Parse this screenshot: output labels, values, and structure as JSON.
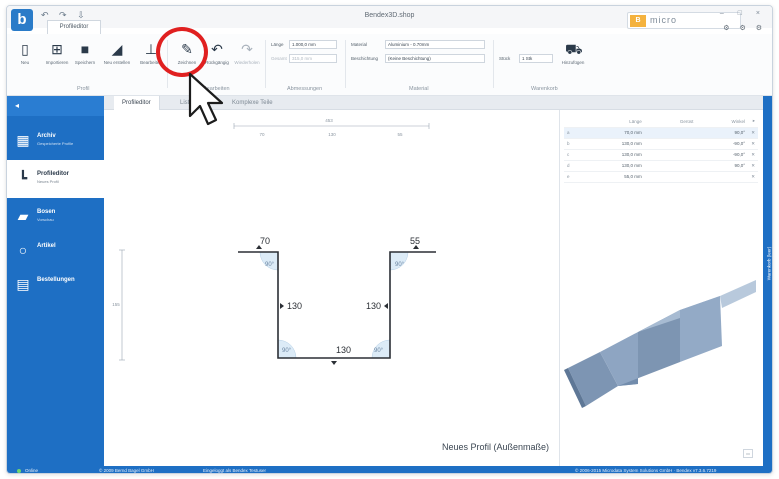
{
  "app": {
    "logo_letter": "b",
    "quick_access": "↶ ↷ ⇩",
    "title": "Bendex3D.shop",
    "tab": "Profileditor",
    "brand_mark": "B",
    "brand_text": "micro",
    "window_controls": "– □ ×",
    "window_controls_2": "⚙ ⚙ ⚙"
  },
  "ribbon": {
    "buttons": [
      {
        "label": "Neu",
        "icon": "new-file-icon"
      },
      {
        "label": "Importieren",
        "icon": "import-icon"
      },
      {
        "label": "Speichern",
        "icon": "save-icon"
      },
      {
        "label": "Neu erstellen",
        "icon": "bend-icon"
      },
      {
        "label": "Bearbeiten",
        "icon": "edit-profile-icon"
      },
      {
        "label": "Zeichnen",
        "icon": "draw-icon"
      },
      {
        "label": "Rückgängig",
        "icon": "undo-icon"
      },
      {
        "label": "Wiederholen",
        "icon": "redo-icon"
      }
    ],
    "groups": {
      "profil": "Profil",
      "bearbeiten": "Bearbeiten",
      "abmessungen": "Abmessungen",
      "material": "Material",
      "warenkorb": "Warenkorb"
    },
    "fields": {
      "laenge_label": "Länge",
      "laenge_value": "1.000,0 mm",
      "gesamt_label": "Gesamt",
      "gesamt_value": "315,0 mm",
      "material_label": "Material",
      "material_value": "Aluminium - 0.70mm",
      "beschichtung_label": "Beschichtung",
      "beschichtung_value": "(Keine Beschichtung)",
      "stueck_label": "Stück",
      "stueck_value": "1 Stk",
      "hinzufuegen_label": "Hinzufügen"
    }
  },
  "sidebar": {
    "collapse": "◂",
    "items": [
      {
        "title": "Archiv",
        "sub": "Gespeicherte Profile",
        "icon": "archive-icon"
      },
      {
        "title": "Profileditor",
        "sub": "Neues Profil",
        "icon": "profile-editor-icon"
      },
      {
        "title": "Bosen",
        "sub": "Vorschau",
        "icon": "sheets-icon"
      },
      {
        "title": "Artikel",
        "sub": "",
        "icon": "article-icon"
      },
      {
        "title": "Bestellungen",
        "sub": "",
        "icon": "orders-icon"
      }
    ]
  },
  "content_tabs": [
    "Profileditor",
    "Liste",
    "Komplexe Teile"
  ],
  "drawing": {
    "dims": {
      "top_left": "70",
      "top_right": "55",
      "left_mid": "130",
      "right_mid": "130",
      "bottom": "130"
    },
    "angles": [
      "90°",
      "90°",
      "90°",
      "90°"
    ],
    "ruler_top": [
      "453",
      "70",
      "130",
      "55"
    ],
    "ruler_left": "155",
    "profile_name": "Neues Profil (Außenmaße)"
  },
  "segments": {
    "headers": [
      "",
      "Länge",
      "Gerüst",
      "Winkel"
    ],
    "rows": [
      {
        "idx": "a",
        "length": "70,0 mm",
        "angle": "90,0°"
      },
      {
        "idx": "b",
        "length": "130,0 mm",
        "angle": "-90,0°"
      },
      {
        "idx": "c",
        "length": "130,0 mm",
        "angle": "-90,0°"
      },
      {
        "idx": "d",
        "length": "130,0 mm",
        "angle": "90,0°"
      },
      {
        "idx": "e",
        "length": "55,0 mm",
        "angle": ""
      }
    ]
  },
  "right_strip_label": "Warenkorb (leer)",
  "statusbar": {
    "status": "Online",
    "company": "© 2009 Bernd Bagel GmbH",
    "user": "Eingeloggt als Bendex Testuser",
    "copyright": "© 2006-2015 Microdata System Solutions GmbH · Bendex v7.3.6.7219"
  },
  "colors": {
    "sidebar": "#1e6fc4",
    "highlight": "#e02020",
    "profile_fill": "#7d95b3"
  }
}
